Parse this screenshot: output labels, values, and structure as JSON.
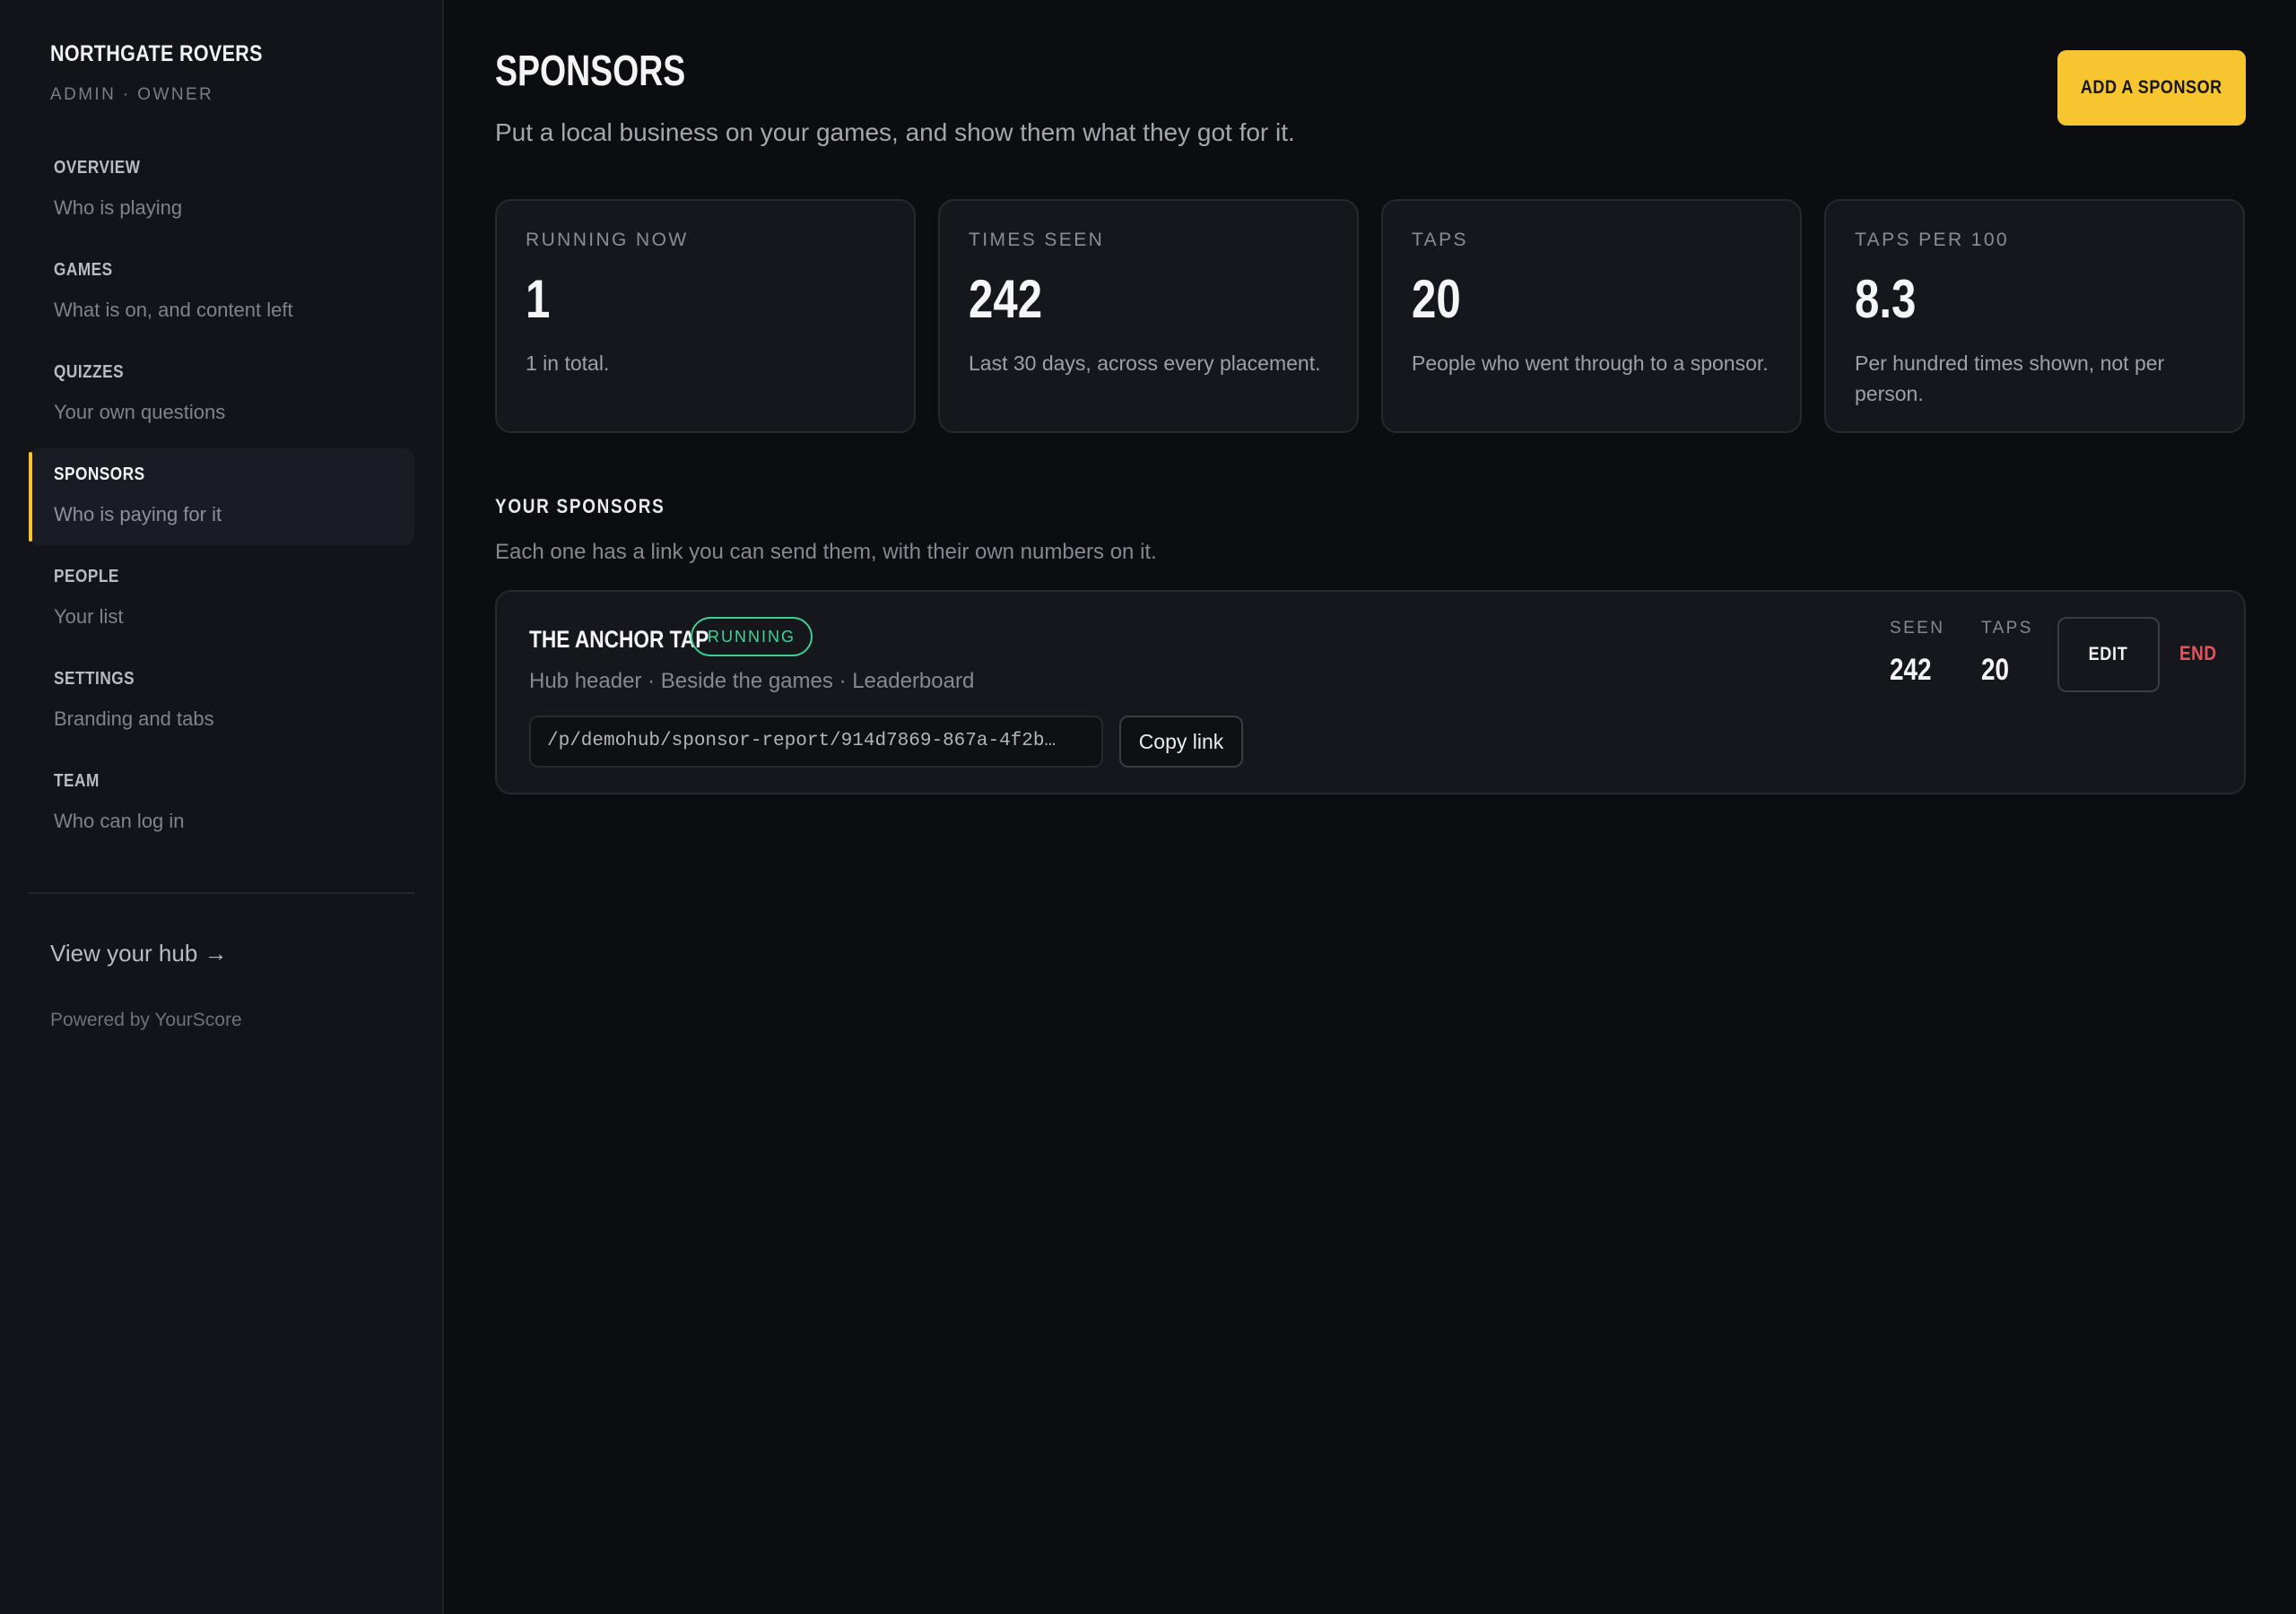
{
  "brand": {
    "name": "NORTHGATE ROVERS",
    "role": "ADMIN · OWNER"
  },
  "nav": [
    {
      "label": "OVERVIEW",
      "sub": "Who is playing"
    },
    {
      "label": "GAMES",
      "sub": "What is on, and content left"
    },
    {
      "label": "QUIZZES",
      "sub": "Your own questions"
    },
    {
      "label": "SPONSORS",
      "sub": "Who is paying for it",
      "active": true
    },
    {
      "label": "PEOPLE",
      "sub": "Your list"
    },
    {
      "label": "SETTINGS",
      "sub": "Branding and tabs"
    },
    {
      "label": "TEAM",
      "sub": "Who can log in"
    }
  ],
  "sidebar_footer": {
    "view_hub": "View your hub →",
    "powered": "Powered by YourScore"
  },
  "header": {
    "title": "SPONSORS",
    "subtitle": "Put a local business on your games, and show them what they got for it.",
    "add_button": "ADD A SPONSOR"
  },
  "stats": [
    {
      "label": "RUNNING NOW",
      "value": "1",
      "note": "1 in total."
    },
    {
      "label": "TIMES SEEN",
      "value": "242",
      "note": "Last 30 days, across every placement."
    },
    {
      "label": "TAPS",
      "value": "20",
      "note": "People who went through to a sponsor."
    },
    {
      "label": "TAPS PER 100",
      "value": "8.3",
      "note": "Per hundred times shown, not per person."
    }
  ],
  "sponsors_section": {
    "title": "YOUR SPONSORS",
    "subtitle": "Each one has a link you can send them, with their own numbers on it."
  },
  "sponsors": [
    {
      "name": "THE ANCHOR TAP",
      "status": "RUNNING",
      "placements": "Hub header · Beside the games · Leaderboard",
      "link": "/p/demohub/sponsor-report/914d7869-867a-4f2b…",
      "copy_label": "Copy link",
      "seen_label": "SEEN",
      "seen": "242",
      "taps_label": "TAPS",
      "taps": "20",
      "edit_label": "EDIT",
      "end_label": "END"
    }
  ],
  "colors": {
    "accent": "#f6c52f",
    "running": "#41d497",
    "danger": "#e3545c"
  }
}
